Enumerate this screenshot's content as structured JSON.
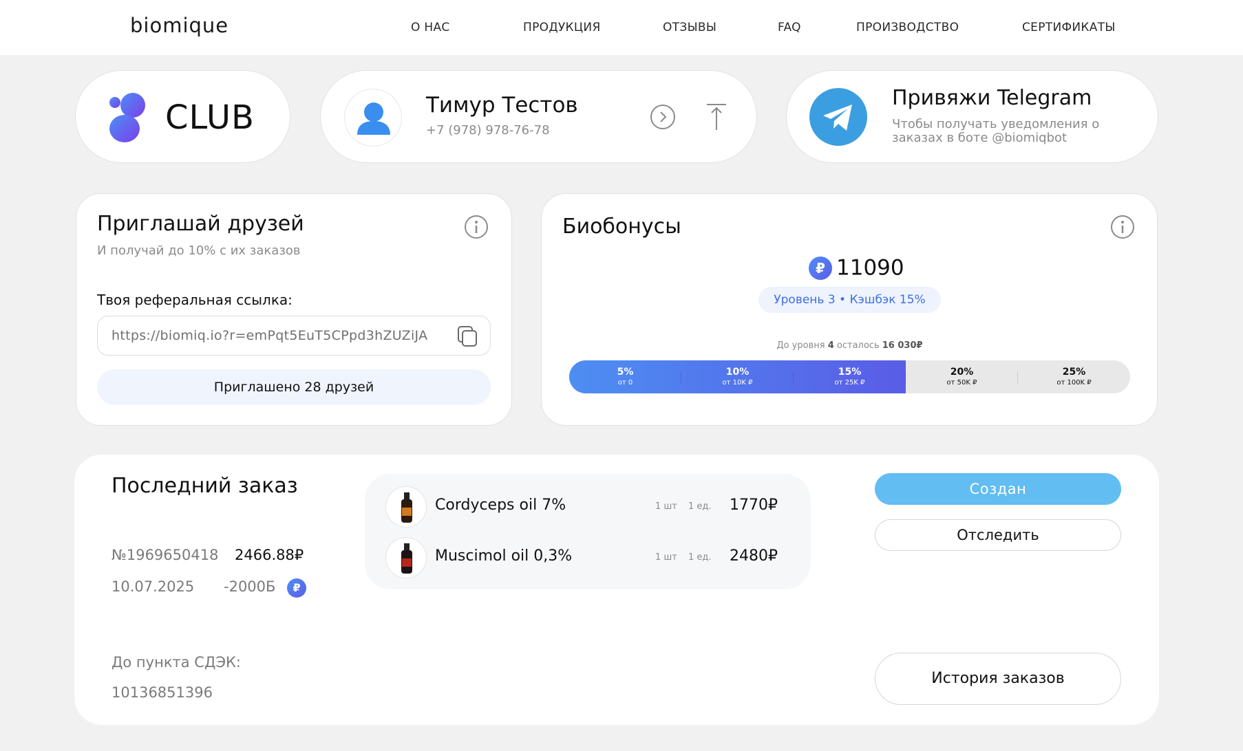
{
  "header": {
    "logo": "biomique",
    "nav": [
      "О НАС",
      "ПРОДУКЦИЯ",
      "ОТЗЫВЫ",
      "FAQ",
      "ПРОИЗВОДСТВО",
      "СЕРТИФИКАТЫ"
    ]
  },
  "club": {
    "title": "CLUB"
  },
  "profile": {
    "name": "Тимур Тестов",
    "phone": "+7 (978) 978-76-78"
  },
  "telegram": {
    "title": "Привяжи Telegram",
    "desc": "Чтобы получать уведомления о заказах в боте @biomiqbot"
  },
  "invite": {
    "title": "Приглашай друзей",
    "subtitle": "И получай до 10% с их заказов",
    "ref_label": "Твоя реферальная ссылка:",
    "ref_link": "https://biomiq.io?r=emPqt5EuT5CPpd3hZUZiJA",
    "invited": "Приглашено 28 друзей"
  },
  "bonus": {
    "title": "Биобонусы",
    "currency_symbol": "₽",
    "amount": "11090",
    "level_text": "Уровень  3 • Кэшбэк  15%",
    "to_level_prefix": "До уровня",
    "to_level_num": "4",
    "to_level_mid": "осталось",
    "to_level_remaining": "16 030₽",
    "progress_fraction": 0.6,
    "tiers": [
      {
        "pct": "5%",
        "sub": "от 0"
      },
      {
        "pct": "10%",
        "sub": "от 10K ₽"
      },
      {
        "pct": "15%",
        "sub": "от 25K ₽"
      },
      {
        "pct": "20%",
        "sub": "от 50K ₽"
      },
      {
        "pct": "25%",
        "sub": "от 100K ₽"
      }
    ]
  },
  "order": {
    "title": "Последний заказ",
    "number": "№1969650418",
    "total": "2466.88₽",
    "date": "10.07.2025",
    "bonus_used": "-2000Б",
    "delivery_label": "До пункта СДЭК:",
    "delivery_code": "10136851396",
    "items": [
      {
        "name": "Cordyceps oil 7%",
        "qty": "1 шт",
        "unit": "1 ед.",
        "price": "1770₽"
      },
      {
        "name": "Muscimol oil 0,3%",
        "qty": "1 шт",
        "unit": "1 ед.",
        "price": "2480₽"
      }
    ],
    "status": "Создан",
    "track": "Отследить",
    "history": "История заказов"
  },
  "colors": {
    "accent": "#5a5ce6",
    "status_button": "#62bdf2",
    "telegram": "#3b9ee0"
  }
}
